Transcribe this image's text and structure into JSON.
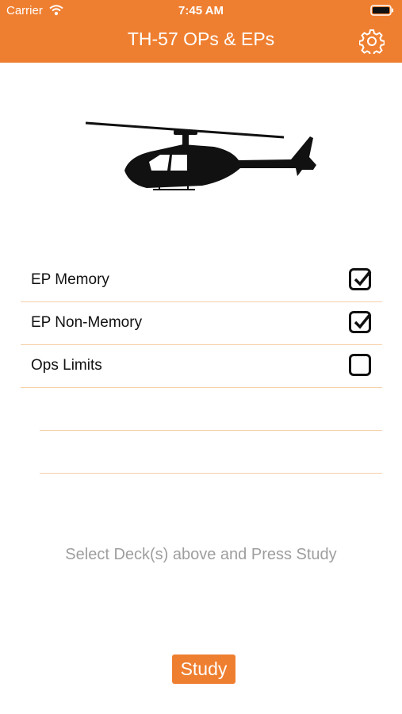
{
  "status_bar": {
    "carrier": "Carrier",
    "time": "7:45 AM"
  },
  "nav": {
    "title": "TH-57 OPs & EPs"
  },
  "decks": [
    {
      "label": "EP Memory",
      "checked": true
    },
    {
      "label": "EP Non-Memory",
      "checked": true
    },
    {
      "label": "Ops Limits",
      "checked": false
    }
  ],
  "hint": "Select Deck(s) above and Press Study",
  "study_button": "Study",
  "colors": {
    "accent": "#ef7f30",
    "divider": "#f6d1a8",
    "hint_text": "#9e9e9e"
  }
}
